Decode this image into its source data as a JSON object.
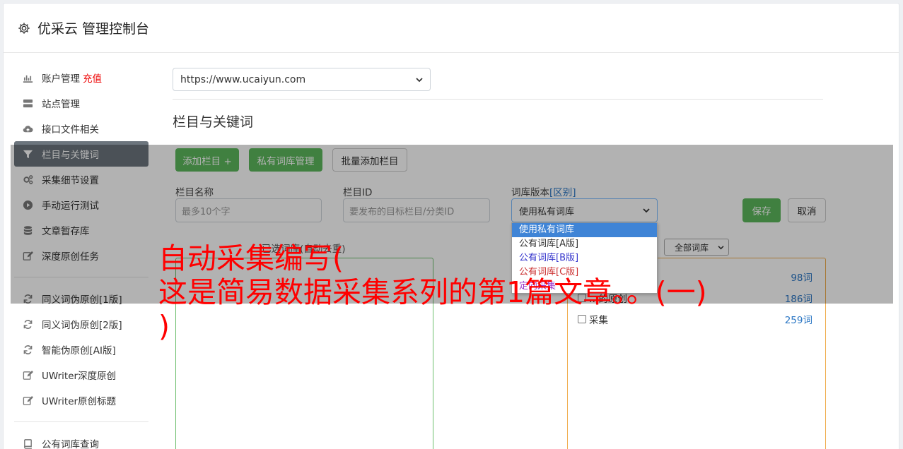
{
  "header": {
    "title": "优采云 管理控制台"
  },
  "sidebar": {
    "items": [
      {
        "label": "账户管理",
        "extra": "充值",
        "icon": "bar-chart-icon"
      },
      {
        "label": "站点管理",
        "icon": "server-icon"
      },
      {
        "label": "接口文件相关",
        "icon": "cloud-upload-icon"
      },
      {
        "label": "栏目与关键词",
        "icon": "filter-icon",
        "active": true
      },
      {
        "label": "采集细节设置",
        "icon": "cogs-icon"
      },
      {
        "label": "手动运行测试",
        "icon": "play-circle-icon"
      },
      {
        "label": "文章暂存库",
        "icon": "database-icon"
      },
      {
        "label": "深度原创任务",
        "icon": "edit-icon"
      }
    ],
    "items2": [
      {
        "label": "同义词伪原创[1版]",
        "icon": "refresh-icon"
      },
      {
        "label": "同义词伪原创[2版]",
        "icon": "refresh-icon"
      },
      {
        "label": "智能伪原创[AI版]",
        "icon": "refresh-icon"
      },
      {
        "label": "UWriter深度原创",
        "icon": "edit-icon"
      },
      {
        "label": "UWriter原创标题",
        "icon": "edit-icon"
      }
    ],
    "items3": [
      {
        "label": "公有词库查询",
        "icon": "book-icon"
      }
    ]
  },
  "main": {
    "site_select": "https://www.ucaiyun.com",
    "section_title": "栏目与关键词",
    "buttons": {
      "add_column": "添加栏目 +",
      "private_lib": "私有词库管理",
      "batch_add": "批量添加栏目"
    },
    "form": {
      "name_label": "栏目名称",
      "name_placeholder": "最多10个字",
      "id_label": "栏目ID",
      "id_placeholder": "要发布的目标栏目/分类ID",
      "version_label": "词库版本",
      "version_link": "[区别]",
      "version_value": "使用私有词库",
      "save": "保存",
      "cancel": "取消"
    },
    "dropdown_options": [
      "使用私有词库",
      "公有词库[A版]",
      "公有词库[B版]",
      "公有词库[C版]",
      "定向采集"
    ],
    "dropdown_colors": [
      "#ffffff",
      "#333333",
      "#3333cc",
      "#cc3333",
      "#9933cc"
    ],
    "left_panel_title": "已选词库(自动去重)",
    "filter_select": "全部词库",
    "keyword_rows": [
      {
        "name": "",
        "count": "98词"
      },
      {
        "name": "…的原创",
        "count": "186词"
      },
      {
        "name": "采集",
        "count": "259词"
      }
    ]
  },
  "overlay_text": {
    "line1": "自动采集编写(",
    "line2": "这是简易数据采集系列的第1篇文章。。(一)",
    "line3": ")"
  }
}
